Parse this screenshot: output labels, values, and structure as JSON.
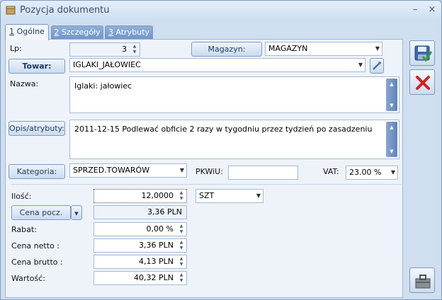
{
  "window": {
    "title": "Pozycja dokumentu",
    "minimize": "–",
    "close": "×"
  },
  "tabs": [
    {
      "num": "1",
      "label": " Ogólne"
    },
    {
      "num": "2",
      "label": " Szczegóły"
    },
    {
      "num": "3",
      "label": " Atrybuty"
    }
  ],
  "form": {
    "lp_label": "Lp:",
    "lp_value": "3",
    "magazyn_button": "Magazyn:",
    "magazyn_value": "MAGAZYN",
    "towar_button": "Towar:",
    "towar_value": "IGLAKI_JAŁOWIEC",
    "nazwa_label": "Nazwa:",
    "nazwa_value": "Iglaki: jałowiec",
    "opis_button": "Opis/atrybuty:",
    "opis_value": "2011-12-15 Podlewać obficie 2 razy w tygodniu przez tydzień po zasadzeniu",
    "kategoria_button": "Kategoria:",
    "kategoria_value": "SPRZED.TOWARÓW",
    "pkwiu_label": "PKWiU:",
    "pkwiu_value": "",
    "vat_label": "VAT:",
    "vat_value": "23.00 %",
    "ilosc_label": "Ilość:",
    "ilosc_value": "12,0000",
    "jm_value": "SZT",
    "cena_pocz_button": "Cena pocz.",
    "cena_pocz_value": "3,36 PLN",
    "rabat_label": "Rabat:",
    "rabat_value": "0,00 %",
    "cena_netto_label": "Cena netto :",
    "cena_netto_value": "3,36 PLN",
    "cena_brutto_label": "Cena brutto :",
    "cena_brutto_value": "4,13 PLN",
    "wartosc_label": "Wartość:",
    "wartosc_value": "40,32 PLN"
  },
  "icons": {
    "save": "save-icon",
    "cancel": "cancel-icon",
    "toolbox": "toolbox-icon",
    "towar_picker": "pipette-icon"
  }
}
